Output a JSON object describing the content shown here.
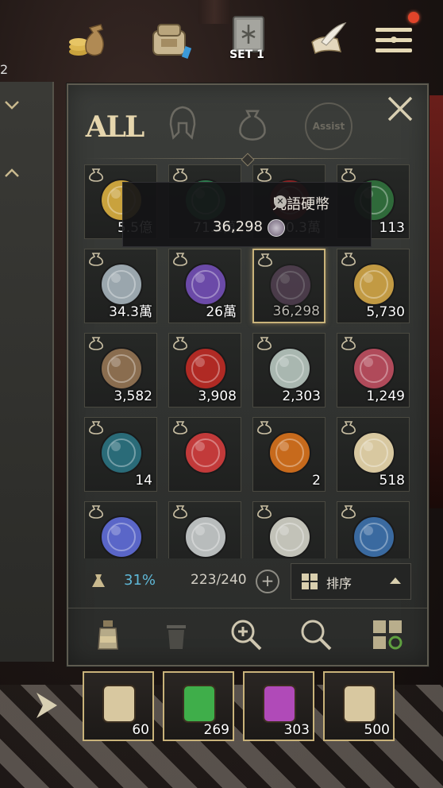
{
  "topbar": {
    "set_label": "SET 1",
    "left_number": "2",
    "icons": [
      "coin-bag-icon",
      "backpack-icon",
      "spellbook-icon",
      "quill-scroll-icon",
      "menu-icon"
    ]
  },
  "inventory": {
    "tabs": [
      {
        "id": "all",
        "label": "ALL",
        "active": true
      },
      {
        "id": "equipment",
        "icon": "helmet-icon"
      },
      {
        "id": "materials",
        "icon": "pouch-icon"
      },
      {
        "id": "assist",
        "label": "Assist"
      }
    ],
    "tooltip": {
      "title": "咒語硬幣",
      "value": "36,298"
    },
    "items": [
      {
        "name": "gold-coins",
        "qty": "5.5億",
        "color": "#c9a23d"
      },
      {
        "name": "green-seal",
        "qty": "71.2萬",
        "color": "#2d7a4d"
      },
      {
        "name": "red-seal",
        "qty": "30.3萬",
        "color": "#8a2222"
      },
      {
        "name": "green-tree-seal",
        "qty": "113",
        "color": "#2f6a3a"
      },
      {
        "name": "bow-coin",
        "qty": "34.3萬",
        "color": "#9aa6ad"
      },
      {
        "name": "purple-card-chip",
        "qty": "26萬",
        "color": "#6b4aa8"
      },
      {
        "name": "spell-coin",
        "qty": "36,298",
        "color": "#6b4f6a",
        "selected": true
      },
      {
        "name": "lion-gold-coin",
        "qty": "5,730",
        "color": "#c29a43"
      },
      {
        "name": "spiral-pouch",
        "qty": "3,582",
        "color": "#8a6d4f"
      },
      {
        "name": "crossed-swords-seal",
        "qty": "3,908",
        "color": "#b02a24"
      },
      {
        "name": "white-crystals",
        "qty": "2,303",
        "color": "#a9b7b0"
      },
      {
        "name": "red-crystals",
        "qty": "1,249",
        "color": "#b04a5a"
      },
      {
        "name": "infinity-seal",
        "qty": "14",
        "color": "#2a6b78"
      },
      {
        "name": "red-crystal",
        "qty": "",
        "color": "#c23a3a"
      },
      {
        "name": "lv-medal",
        "qty": "2",
        "color": "#c76a1c"
      },
      {
        "name": "cross-scroll",
        "qty": "518",
        "color": "#d8c8a0"
      },
      {
        "name": "cosmic-crystal",
        "qty": "",
        "color": "#5a66c8"
      },
      {
        "name": "silver-ore",
        "qty": "",
        "color": "#b8bcbc"
      },
      {
        "name": "cross-coin",
        "qty": "",
        "color": "#c2c2b8"
      },
      {
        "name": "blue-card",
        "qty": "",
        "color": "#3a6aa0"
      }
    ],
    "weight_percent": "31%",
    "slots_used": "223/240",
    "sort_label": "排序"
  },
  "quickbar": {
    "slots": [
      {
        "name": "home-scroll",
        "qty": "60"
      },
      {
        "name": "green-potion",
        "qty": "269"
      },
      {
        "name": "purple-potion",
        "qty": "303"
      },
      {
        "name": "return-scroll",
        "qty": "500"
      }
    ]
  },
  "colors": {
    "accent_gold": "#c9b37a",
    "weight_blue": "#5fb8d8",
    "panel_bg": "#333533"
  }
}
